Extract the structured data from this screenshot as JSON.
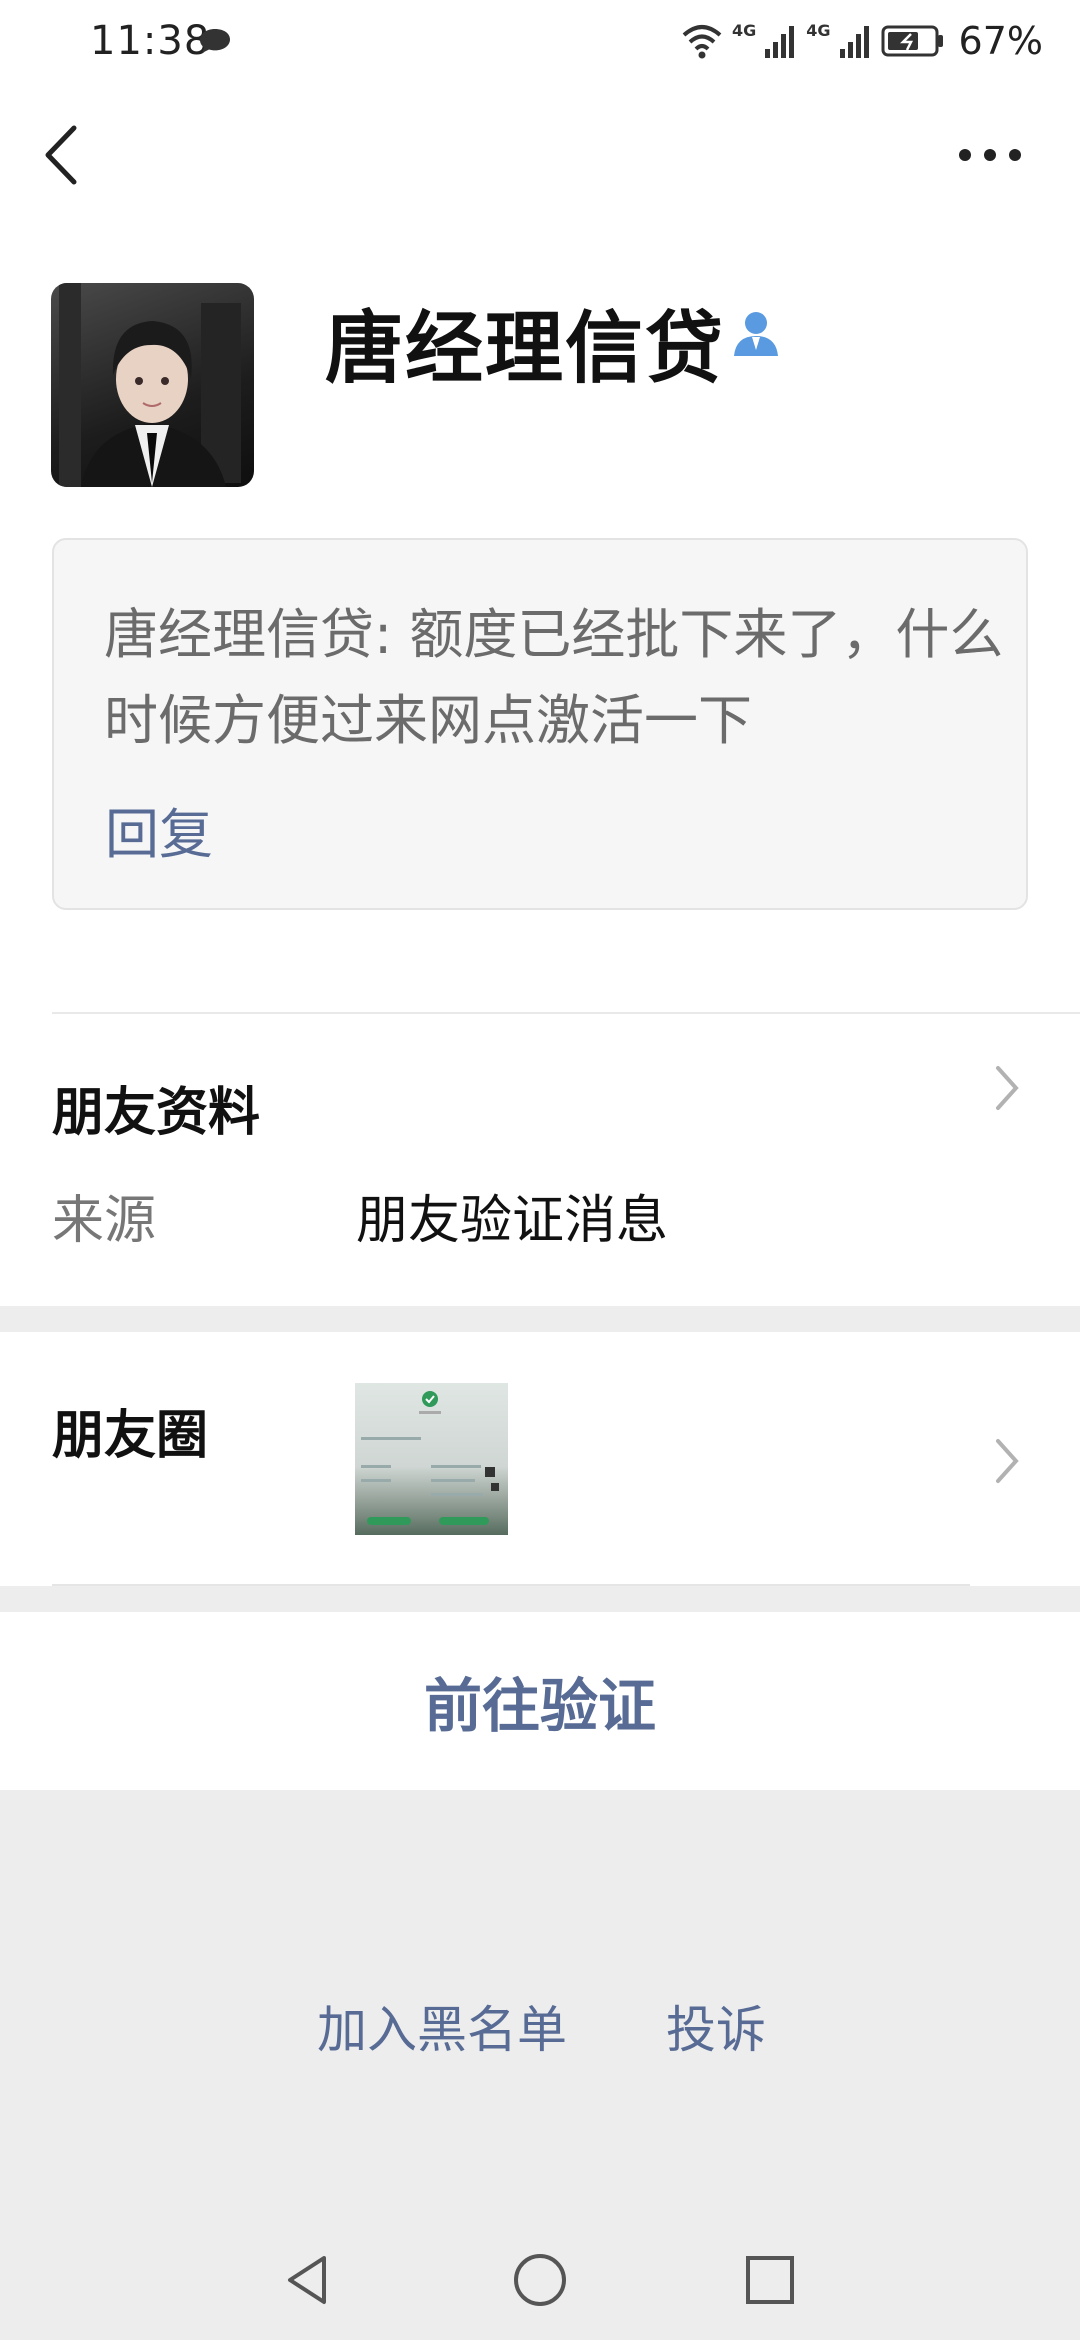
{
  "status_bar": {
    "time": "11:38",
    "battery": "67%",
    "network_1": "4G",
    "network_2": "4G"
  },
  "contact": {
    "name": "唐经理信贷",
    "verify_message": "唐经理信贷: 额度已经批下来了，什么时候方便过来网点激活一下",
    "reply_label": "回复"
  },
  "friend_info": {
    "title": "朋友资料",
    "source_label": "来源",
    "source_value": "朋友验证消息"
  },
  "moments": {
    "title": "朋友圈"
  },
  "actions": {
    "verify_label": "前往验证",
    "blacklist_label": "加入黑名单",
    "report_label": "投诉"
  },
  "colors": {
    "link": "#576b95",
    "verified_badge": "#5a9ae0",
    "background": "#ededed"
  },
  "icons": [
    "chat-bubble-icon",
    "wifi-icon",
    "signal-icon",
    "battery-icon",
    "back-arrow-icon",
    "more-icon",
    "person-badge-icon",
    "chevron-right-icon",
    "nav-back-icon",
    "nav-home-icon",
    "nav-recent-icon"
  ]
}
